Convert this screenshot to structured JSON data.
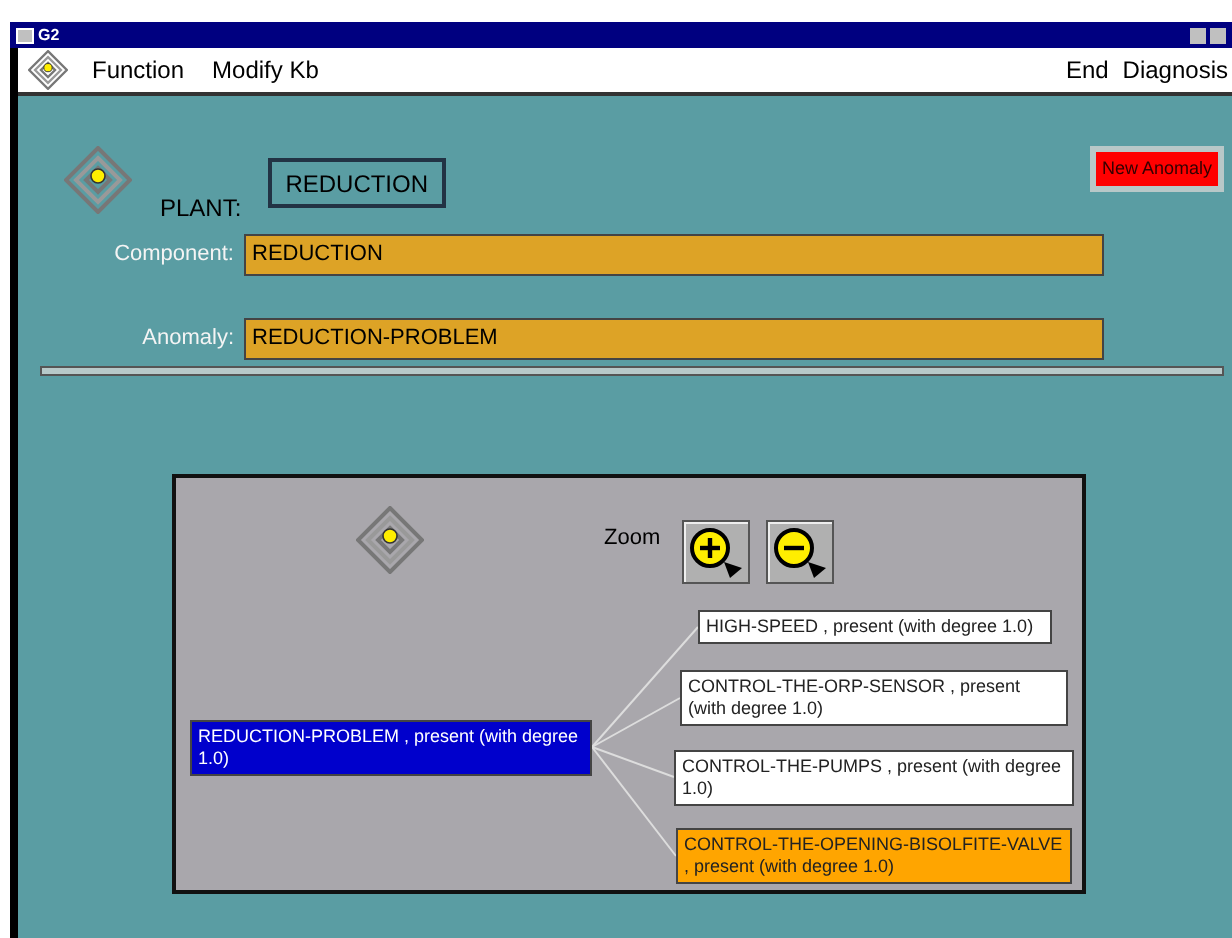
{
  "window": {
    "title": "G2"
  },
  "menu": {
    "left": [
      "Function",
      "Modify Kb"
    ],
    "right": [
      "End",
      "Diagnosis"
    ]
  },
  "plant": {
    "label": "PLANT:",
    "value": "REDUCTION"
  },
  "new_anomaly_button": "New Anomaly",
  "fields": [
    {
      "label": "Component:",
      "value": "REDUCTION"
    },
    {
      "label": "Anomaly:",
      "value": "REDUCTION-PROBLEM"
    }
  ],
  "diagram": {
    "zoom_label": "Zoom",
    "root": {
      "text": "REDUCTION-PROBLEM ,    present (with degree 1.0)",
      "color": "#0000cc"
    },
    "children": [
      {
        "text": "HIGH-SPEED ,    present (with degree 1.0)",
        "color": "#ffffff"
      },
      {
        "text": "CONTROL-THE-ORP-SENSOR ,    present (with degree 1.0)",
        "color": "#ffffff"
      },
      {
        "text": "CONTROL-THE-PUMPS ,    present (with degree 1.0)",
        "color": "#ffffff"
      },
      {
        "text": "CONTROL-THE-OPENING-BISOLFITE-VALVE , present (with degree 1.0)",
        "color": "#ffa500"
      }
    ]
  }
}
